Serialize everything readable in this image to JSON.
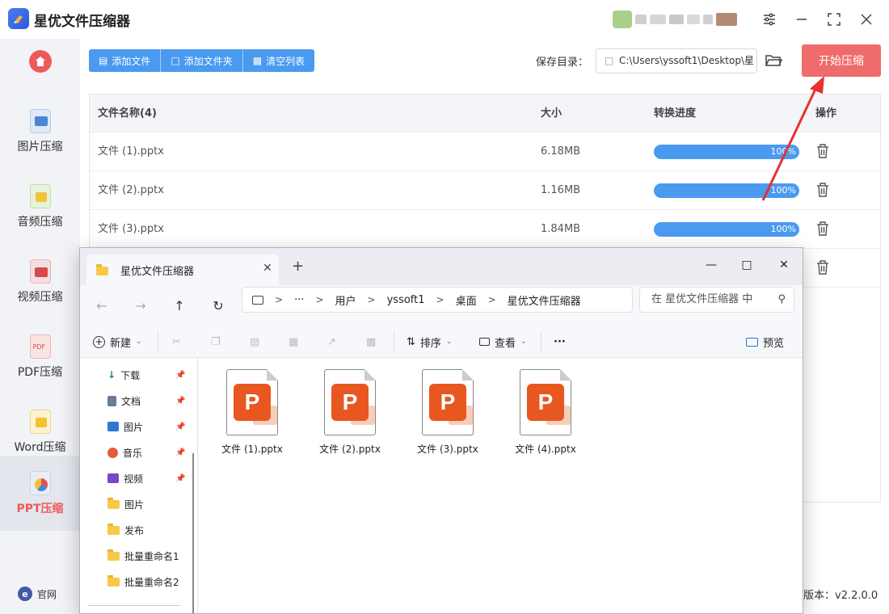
{
  "app": {
    "title": "星优文件压缩器",
    "version": "版本：v2.2.0.0",
    "site_link": "官网"
  },
  "sidebar": {
    "items": [
      {
        "label": "图片压缩",
        "icon": "image-compress-icon"
      },
      {
        "label": "音频压缩",
        "icon": "audio-compress-icon"
      },
      {
        "label": "视频压缩",
        "icon": "video-compress-icon"
      },
      {
        "label": "PDF压缩",
        "icon": "pdf-compress-icon"
      },
      {
        "label": "Word压缩",
        "icon": "word-compress-icon"
      },
      {
        "label": "PPT压缩",
        "icon": "ppt-compress-icon",
        "active": true
      }
    ]
  },
  "toolbar": {
    "add_file": "添加文件",
    "add_folder": "添加文件夹",
    "clear_list": "清空列表",
    "save_label": "保存目录：",
    "save_path": "C:\\Users\\yssoft1\\Desktop\\星",
    "start": "开始压缩"
  },
  "table": {
    "headers": {
      "name": "文件名称(4)",
      "size": "大小",
      "progress": "转换进度",
      "action": "操作"
    },
    "rows": [
      {
        "name": "文件 (1).pptx",
        "size": "6.18MB",
        "progress": "100%"
      },
      {
        "name": "文件 (2).pptx",
        "size": "1.16MB",
        "progress": "100%"
      },
      {
        "name": "文件 (3).pptx",
        "size": "1.84MB",
        "progress": "100%"
      }
    ]
  },
  "explorer": {
    "tab_title": "星优文件压缩器",
    "breadcrumb": [
      "用户",
      "yssoft1",
      "桌面",
      "星优文件压缩器"
    ],
    "search_placeholder": "在 星优文件压缩器 中",
    "commands": {
      "new": "新建",
      "sort": "排序",
      "view": "查看",
      "more": "···",
      "preview": "预览"
    },
    "nav": [
      {
        "label": "下载",
        "pinned": true
      },
      {
        "label": "文档",
        "pinned": true
      },
      {
        "label": "图片",
        "pinned": true
      },
      {
        "label": "音乐",
        "pinned": true
      },
      {
        "label": "视频",
        "pinned": true
      },
      {
        "label": "图片",
        "pinned": false
      },
      {
        "label": "发布",
        "pinned": false
      },
      {
        "label": "批量重命名1",
        "pinned": false
      },
      {
        "label": "批量重命名2",
        "pinned": false
      }
    ],
    "files": [
      "文件 (1).pptx",
      "文件 (2).pptx",
      "文件 (3).pptx",
      "文件 (4).pptx"
    ]
  },
  "colors": {
    "accent_blue": "#4a9af0",
    "accent_red": "#f06b6b",
    "ppt_orange": "#e8571f"
  }
}
